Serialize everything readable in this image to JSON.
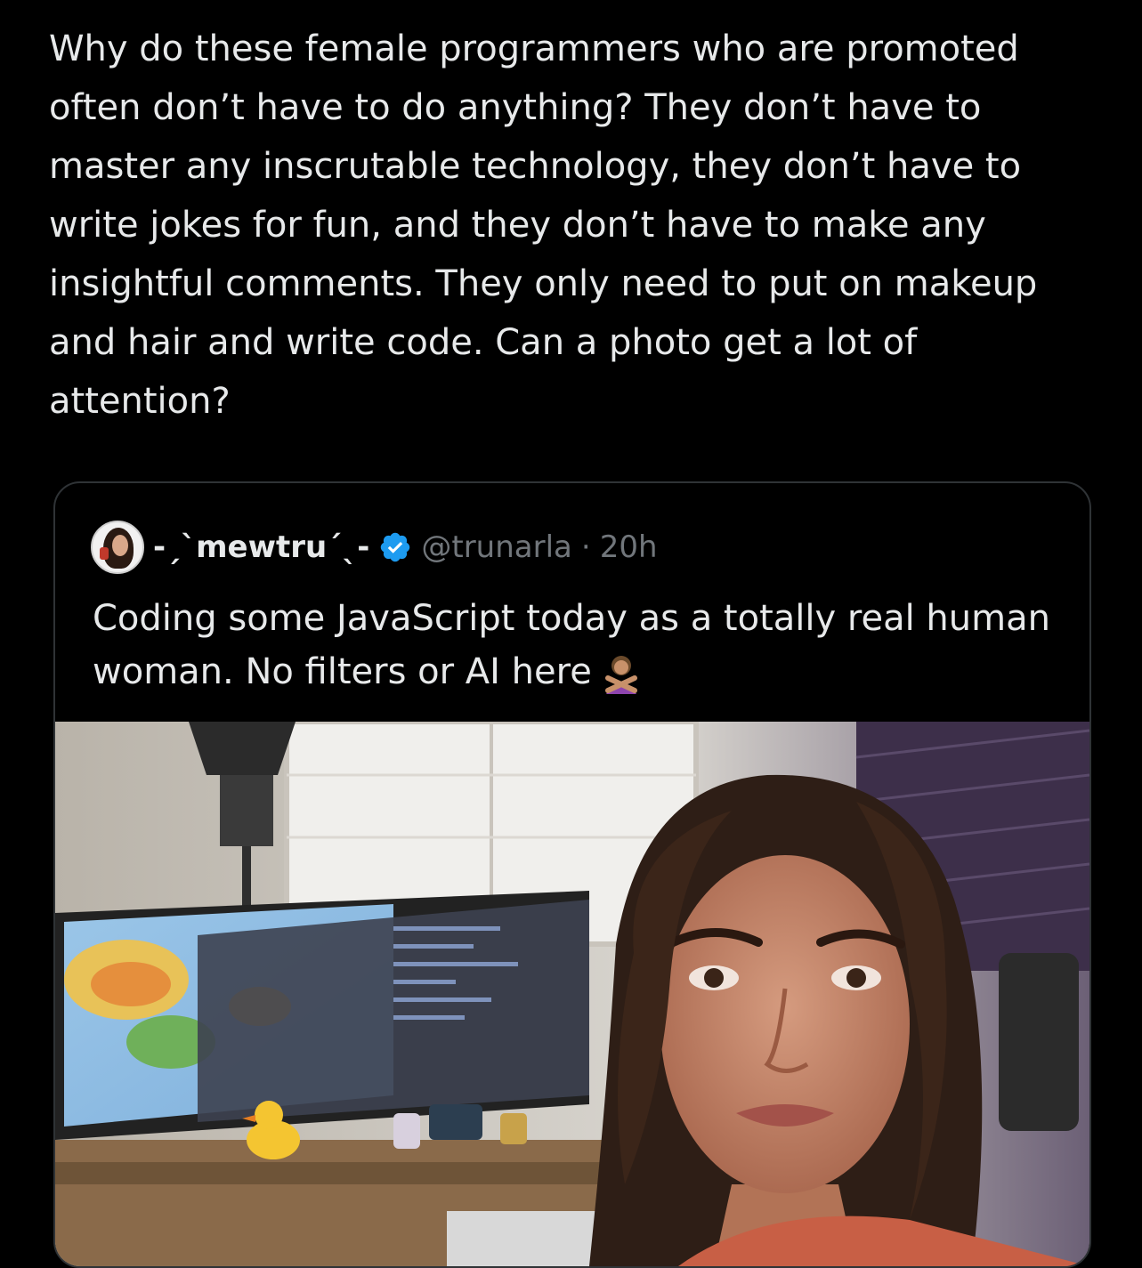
{
  "tweet": {
    "text": "Why do these female programmers who are promoted often don’t have to do anything? They don’t have to master any inscrutable technology, they don’t have to write jokes for fun, and they don’t have to make any insightful comments. They only need to put on makeup and hair and write code. Can a photo get a lot of attention?"
  },
  "quoted_tweet": {
    "display_name": "-ˏˋmewtruˊˎ-",
    "handle": "@trunarla",
    "separator": "·",
    "time": "20h",
    "text": "Coding some JavaScript today as a totally real human woman. No filters or AI here",
    "emoji_icon": "person-gesturing-no-emoji",
    "verified_color": "#1d9bf0"
  }
}
